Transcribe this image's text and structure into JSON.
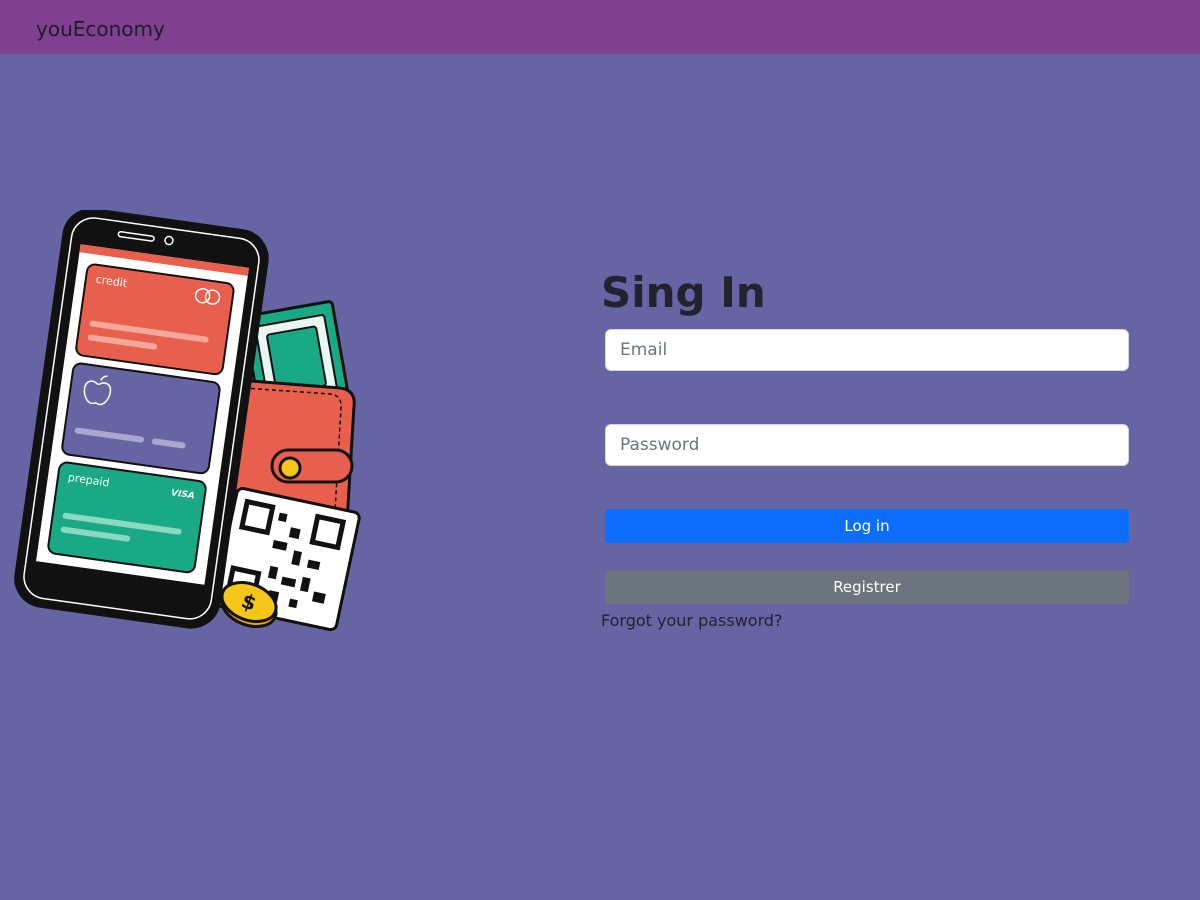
{
  "header": {
    "brand": "youEconomy"
  },
  "illustration": {
    "credit_card_label": "credit",
    "prepaid_card_label": "prepaid",
    "visa_label": "VISA",
    "colors": {
      "red": "#e8604d",
      "green": "#1aa985",
      "purple": "#6664a2",
      "yellow": "#f5c518"
    }
  },
  "form": {
    "title": "Sing In",
    "email_placeholder": "Email",
    "password_placeholder": "Password",
    "login_label": "Log in",
    "register_label": "Registrer",
    "forgot_label": "Forgot your password?"
  },
  "colors": {
    "navbar": "#7f418f",
    "background": "#6664a2",
    "primary": "#0d6efd",
    "secondary": "#6c757d"
  }
}
